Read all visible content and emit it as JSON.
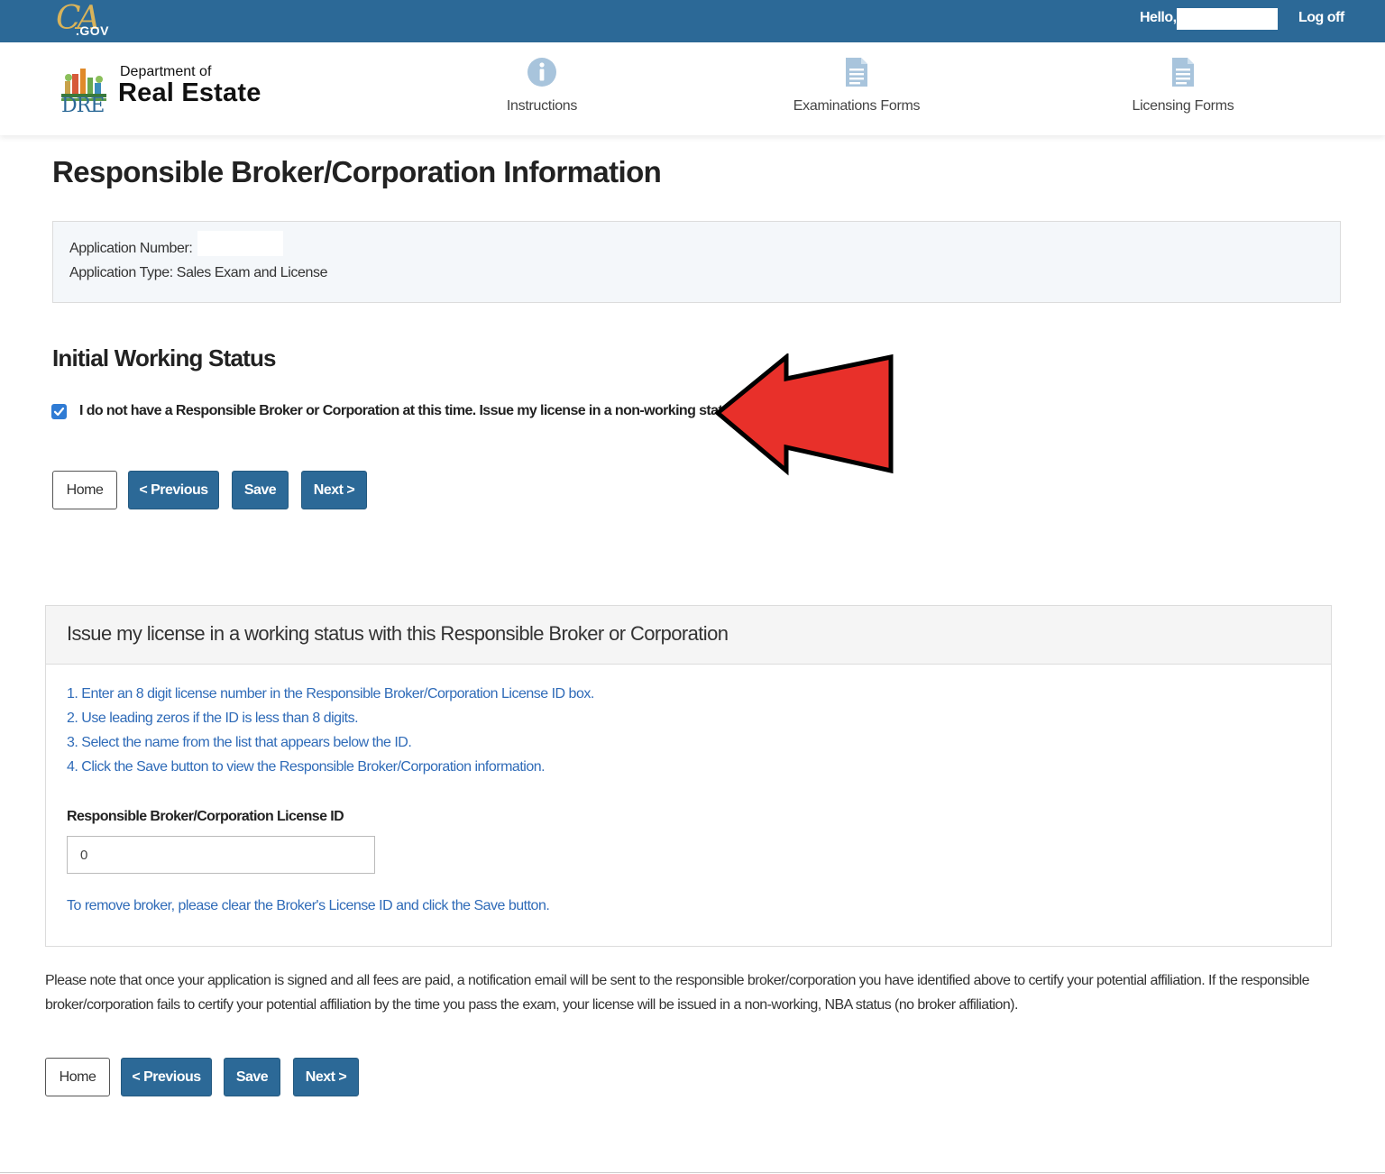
{
  "topbar": {
    "logo_ca": "CA",
    "logo_gov": ".GOV",
    "hello": "Hello,",
    "logoff": "Log off"
  },
  "header": {
    "dept_small": "Department of",
    "dept_big": "Real Estate",
    "dre": "DRE",
    "nav": [
      {
        "label": "Instructions",
        "icon": "info-icon"
      },
      {
        "label": "Examinations Forms",
        "icon": "document-icon"
      },
      {
        "label": "Licensing Forms",
        "icon": "document-icon"
      }
    ]
  },
  "page": {
    "title": "Responsible Broker/Corporation Information",
    "application_number_label": "Application Number:",
    "application_type_label": "Application Type: Sales Exam and License"
  },
  "working_status": {
    "heading": "Initial Working Status",
    "checkbox_checked": true,
    "checkbox_label": "I do not have a Responsible Broker or Corporation at this time. Issue my license in a non-working status."
  },
  "buttons": {
    "home": "Home",
    "previous": "< Previous",
    "save": "Save",
    "next": "Next >"
  },
  "panel": {
    "title": "Issue my license in a working status with this Responsible Broker or Corporation",
    "instructions": [
      "1. Enter an 8 digit license number in the Responsible Broker/Corporation License ID box.",
      "2. Use leading zeros if the ID is less than 8 digits.",
      "3. Select the name from the list that appears below the ID.",
      "4. Click the Save button to view the Responsible Broker/Corporation information."
    ],
    "field_label": "Responsible Broker/Corporation License ID",
    "field_value": "0",
    "remove_note": "To remove broker, please clear the Broker's License ID and click the Save button."
  },
  "note": "Please note that once your application is signed and all fees are paid, a notification email will be sent to the responsible broker/corporation you have identified above to certify your potential affiliation. If the responsible broker/corporation fails to certify your potential affiliation by the time you pass the exam, your license will be issued in a non-working, NBA status (no broker affiliation).",
  "colors": {
    "brand_blue": "#2c6997",
    "link_blue": "#2f6bb8",
    "arrow_red": "#e8302a"
  }
}
